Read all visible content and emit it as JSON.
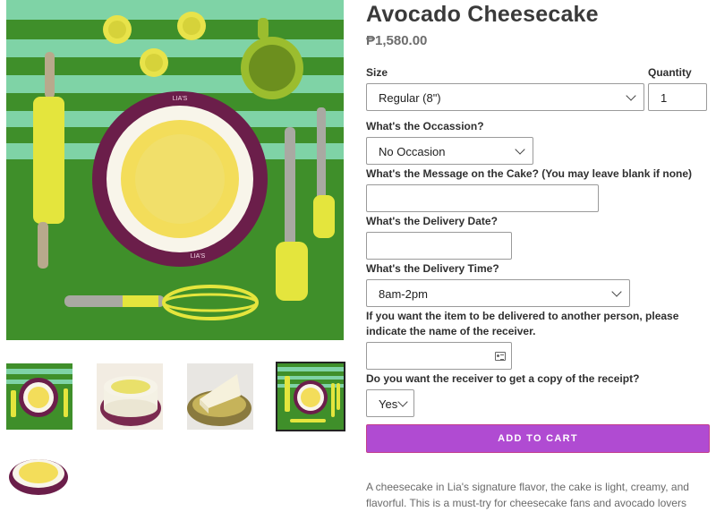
{
  "product": {
    "title": "Avocado Cheesecake",
    "price": "₱1,580.00",
    "description": "A cheesecake in Lia's signature flavor, the cake is light, creamy, and flavorful. This is a must-try for cheesecake fans and avocado lovers"
  },
  "gallery": {
    "plate_text": "LIA'S",
    "thumbnails": [
      {
        "name": "thumb-1"
      },
      {
        "name": "thumb-2"
      },
      {
        "name": "thumb-3"
      },
      {
        "name": "thumb-4",
        "active": true
      },
      {
        "name": "thumb-5"
      }
    ]
  },
  "form": {
    "size": {
      "label": "Size",
      "value": "Regular (8\")"
    },
    "quantity": {
      "label": "Quantity",
      "value": "1"
    },
    "occasion": {
      "label": "What's the Occassion?",
      "value": "No Occasion"
    },
    "message": {
      "label": "What's the Message on the Cake? (You may leave blank if none)",
      "value": ""
    },
    "delivery_date": {
      "label": "What's the Delivery Date?",
      "value": ""
    },
    "delivery_time": {
      "label": "What's the Delivery Time?",
      "value": "8am-2pm"
    },
    "receiver": {
      "label": "If you want the item to be delivered to another person, please indicate the name of the receiver.",
      "value": ""
    },
    "receipt_copy": {
      "label": "Do you want the receiver to get a copy of the receipt?",
      "value": "Yes"
    },
    "add_to_cart": "ADD TO CART"
  },
  "colors": {
    "accent_button": "#b04bd2",
    "plate": "#6b1e4a",
    "background_green": "#3f8f2a"
  }
}
